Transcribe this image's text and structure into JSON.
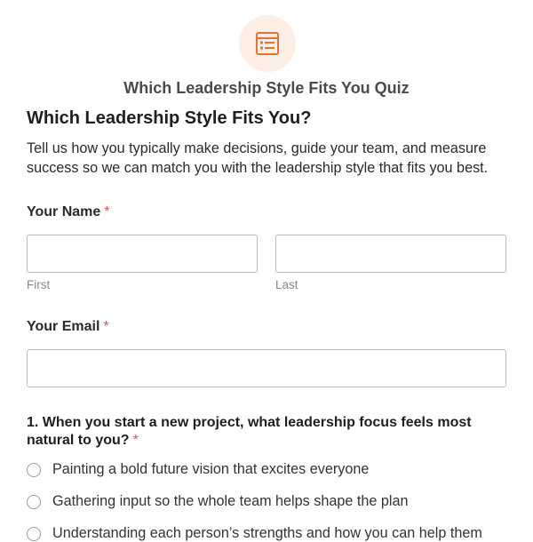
{
  "header": {
    "icon": "form-list-icon",
    "icon_color": "#e8732e",
    "icon_bg": "#fdeee6",
    "form_name": "Which Leadership Style Fits You Quiz"
  },
  "form": {
    "title": "Which Leadership Style Fits You?",
    "description": "Tell us how you typically make decisions, guide your team, and measure success so we can match you with the leadership style that fits you best."
  },
  "fields": {
    "name": {
      "label": "Your Name",
      "required_mark": "*",
      "first_value": "",
      "last_value": "",
      "first_sublabel": "First",
      "last_sublabel": "Last"
    },
    "email": {
      "label": "Your Email",
      "required_mark": "*",
      "value": ""
    }
  },
  "question1": {
    "label": "1. When you start a new project, what leadership focus feels most natural to you?",
    "required_mark": "*",
    "options": [
      "Painting a bold future vision that excites everyone",
      "Gathering input so the whole team helps shape the plan",
      "Understanding each person’s strengths and how you can help them"
    ]
  },
  "colors": {
    "required": "#d9534f",
    "text": "#222222",
    "muted": "#8a8a8a",
    "border": "#bdbdbd"
  }
}
